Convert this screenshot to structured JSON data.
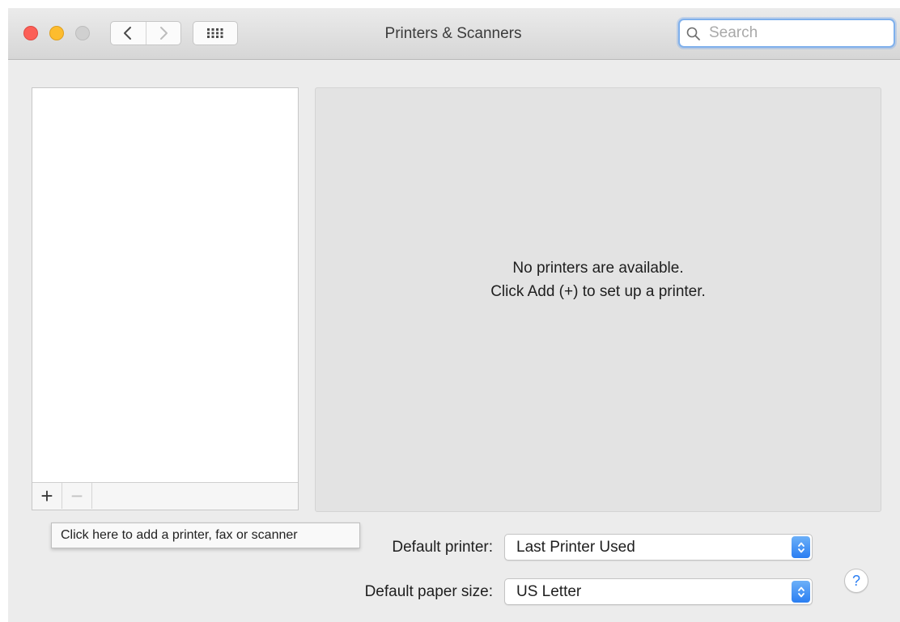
{
  "window": {
    "title": "Printers & Scanners"
  },
  "search": {
    "placeholder": "Search",
    "value": ""
  },
  "list": {
    "add_label": "+",
    "remove_label": "−"
  },
  "detail": {
    "message_line1": "No printers are available.",
    "message_line2": "Click Add (+) to set up a printer."
  },
  "tooltip": {
    "text": "Click here to add a printer, fax or scanner"
  },
  "settings": {
    "default_printer_label": "Default printer:",
    "default_printer_value": "Last Printer Used",
    "default_paper_label": "Default paper size:",
    "default_paper_value": "US Letter"
  },
  "help": {
    "label": "?"
  },
  "colors": {
    "accent": "#2a7ef2",
    "close": "#fc5f57",
    "minimize": "#fdbc2e"
  }
}
